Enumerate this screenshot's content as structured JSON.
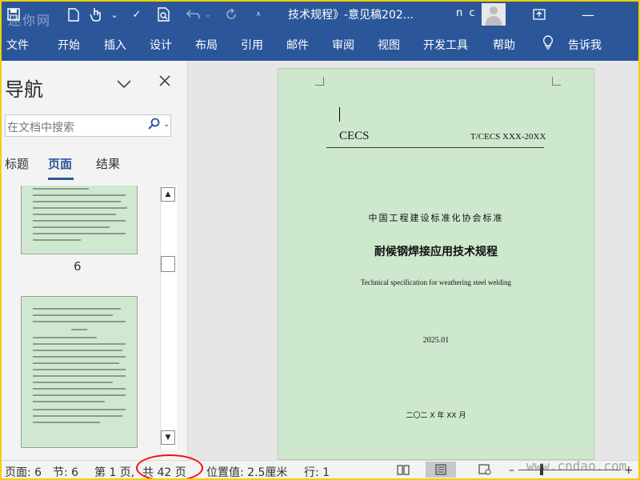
{
  "window": {
    "title": "技术规程》-意见稿202...",
    "user": "n c",
    "watermark_top": "迷你网"
  },
  "quick_access": {
    "undo_icon": "undo-icon",
    "redo_icon": "redo-icon",
    "more_icon": "customize-icon"
  },
  "ribbon": {
    "tabs": [
      "文件",
      "开始",
      "插入",
      "设计",
      "布局",
      "引用",
      "邮件",
      "审阅",
      "视图",
      "开发工具",
      "帮助",
      "告诉我"
    ]
  },
  "nav_pane": {
    "title": "导航",
    "search_placeholder": "在文档中搜索",
    "tabs": [
      "标题",
      "页面",
      "结果"
    ],
    "active_tab": "页面",
    "visible_page_number": "6"
  },
  "document": {
    "header_left": "CECS",
    "header_right": "T/CECS XXX-20XX",
    "organization": "中国工程建设标准化协会标准",
    "title_cn": "耐候钢焊接应用技术规程",
    "title_en": "Technical specification for weathering steel welding",
    "date_line": "2025.01",
    "publish_line": "二〇二 X 年 XX 月"
  },
  "status_bar": {
    "page": "页面: 6",
    "section": "节: 6",
    "page_of": "第 1 页,",
    "total": "共 42 页",
    "position": "位置值: 2.5厘米",
    "line": "行: 1",
    "zoom_minus": "–",
    "zoom_plus": "+"
  },
  "watermark_site": "www.cndao.com",
  "colors": {
    "ribbon": "#2b579a",
    "page_bg": "#cde8cd",
    "highlight": "#ee1111"
  }
}
